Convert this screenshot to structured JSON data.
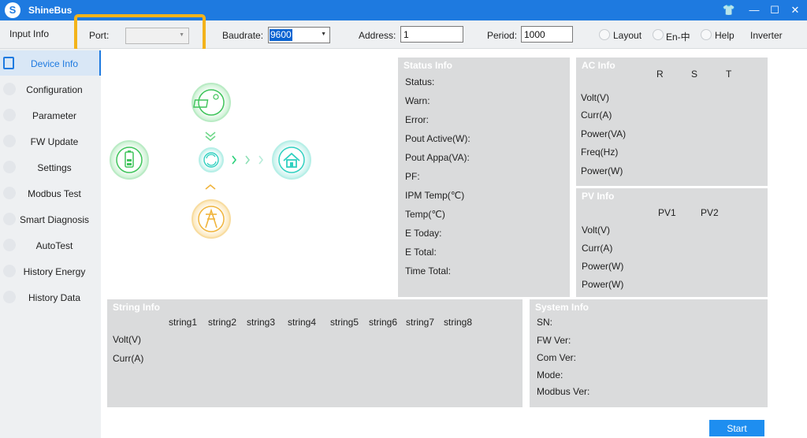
{
  "window": {
    "title": "ShineBus",
    "logo_letter": "S",
    "controls": {
      "skin": "👕",
      "minimize": "—",
      "maximize": "☐",
      "close": "✕"
    }
  },
  "toolbar": {
    "input_info": "Input Info",
    "port_label": "Port:",
    "port_value": "",
    "baudrate_label": "Baudrate:",
    "baudrate_value": "9600",
    "address_label": "Address:",
    "address_value": "1",
    "period_label": "Period:",
    "period_value": "1000",
    "layout": "Layout",
    "language": "En-中",
    "help": "Help",
    "inverter": "Inverter"
  },
  "sidebar": {
    "items": [
      {
        "label": "Device Info",
        "active": true
      },
      {
        "label": "Configuration"
      },
      {
        "label": "Parameter"
      },
      {
        "label": "FW Update"
      },
      {
        "label": "Settings"
      },
      {
        "label": "Modbus Test"
      },
      {
        "label": "Smart Diagnosis"
      },
      {
        "label": "AutoTest"
      },
      {
        "label": "History Energy"
      },
      {
        "label": "History Data"
      }
    ]
  },
  "status_info": {
    "title": "Status Info",
    "fields": [
      "Status:",
      "Warn:",
      "Error:",
      "Pout Active(W):",
      "Pout Appa(VA):",
      "PF:",
      "IPM Temp(℃)",
      "Temp(℃)",
      "E Today:",
      "E Total:",
      "Time Total:"
    ]
  },
  "ac_info": {
    "title": "AC Info",
    "columns": [
      "R",
      "S",
      "T"
    ],
    "rows": [
      "Volt(V)",
      "Curr(A)",
      "Power(VA)",
      "Freq(Hz)",
      "Power(W)"
    ]
  },
  "pv_info": {
    "title": "PV Info",
    "columns": [
      "PV1",
      "PV2"
    ],
    "rows": [
      "Volt(V)",
      "Curr(A)",
      "Power(W)",
      "Power(W)"
    ]
  },
  "string_info": {
    "title": "String Info",
    "columns": [
      "string1",
      "string2",
      "string3",
      "string4",
      "string5",
      "string6",
      "string7",
      "string8"
    ],
    "rows": [
      "Volt(V)",
      "Curr(A)"
    ]
  },
  "system_info": {
    "title": "System Info",
    "fields": [
      "SN:",
      "FW Ver:",
      "Com Ver:",
      "Mode:",
      "Modbus Ver:"
    ]
  },
  "actions": {
    "start": "Start"
  },
  "colors": {
    "accent": "#1e7ae0",
    "highlight": "#f3b31b",
    "panel": "#dadbdc",
    "flow_green": "#3ec45a",
    "flow_cyan": "#2fd0c0",
    "flow_amber": "#f0b43c"
  }
}
